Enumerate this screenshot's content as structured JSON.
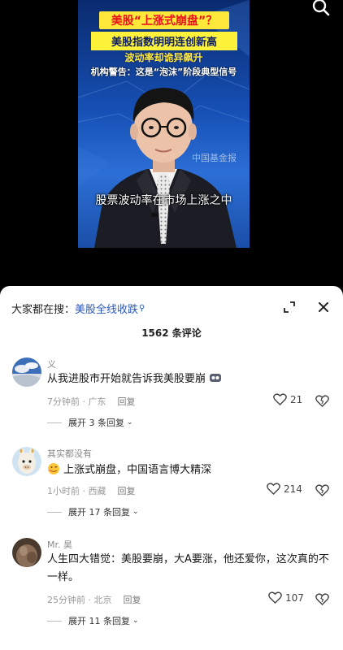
{
  "video": {
    "headline_1": "美股“上涨式崩盘”？",
    "headline_2": "美股指数明明连创新高",
    "headline_3": "波动率却诡异飙升",
    "headline_4": "机构警告：这是“泡沫”阶段典型信号",
    "watermark": "中国基金报",
    "subtitle": "股票波动率在市场上涨之中",
    "top_right_icon": "search-icon"
  },
  "panel": {
    "search_prefix": "大家都在搜：",
    "search_keyword": "美股全线收跌",
    "comment_count": "1562 条评论",
    "expand_icon": "expand-icon",
    "close_icon": "close-icon"
  },
  "comments": [
    {
      "user": "义",
      "text": "从我进股市开始就告诉我美股要崩",
      "time": "7分钟前 · 广东",
      "reply": "回复",
      "likes": "21",
      "expand": "展开 3 条回复"
    },
    {
      "user": "其实都没有",
      "text": "上涨式崩盘，中国语言博大精深",
      "time": "1小时前 · 西藏",
      "reply": "回复",
      "likes": "214",
      "expand": "展开 17 条回复"
    },
    {
      "user": "Mr. 昊",
      "text": "人生四大错觉：美股要崩，大A要涨，他还爱你，这次真的不一样。",
      "time": "25分钟前 · 北京",
      "reply": "回复",
      "likes": "107",
      "expand": "展开 11 条回复"
    }
  ],
  "colors": {
    "keyword": "#2b57b8",
    "video_bg": "#1650b5",
    "headline_red": "#e8101a",
    "headline_yellow": "#ffe83a"
  }
}
